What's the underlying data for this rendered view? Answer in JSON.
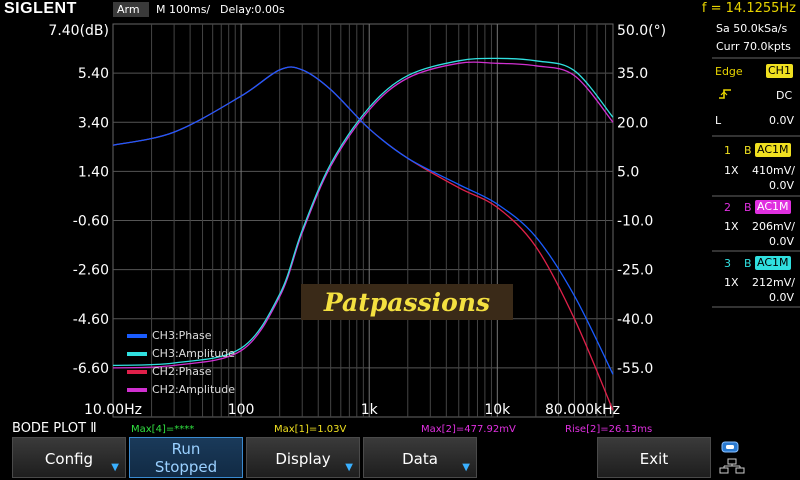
{
  "topbar": {
    "brand": "SIGLENT",
    "trigger_status": "Arm",
    "timebase": "M 100ms/",
    "delay": "Delay:0.00s",
    "frequency": "f = 14.1255Hz"
  },
  "plot": {
    "left_axis_labels": [
      "7.40(dB)",
      "5.40",
      "3.40",
      "1.40",
      "-0.60",
      "-2.60",
      "-4.60",
      "-6.60"
    ],
    "right_axis_labels": [
      "50.0(°)",
      "35.0",
      "20.0",
      "5.0",
      "-10.0",
      "-25.0",
      "-40.0",
      "-55.0"
    ],
    "x_axis_labels": [
      "10.00Hz",
      "100",
      "1k",
      "10k",
      "80.000kHz"
    ],
    "watermark": "Patpassions",
    "legend": [
      {
        "name": "CH3:Phase",
        "color": "#1a5cff"
      },
      {
        "name": "CH3:Amplitude",
        "color": "#30e0e0"
      },
      {
        "name": "CH2:Phase",
        "color": "#e0204a"
      },
      {
        "name": "CH2:Amplitude",
        "color": "#d030d0"
      }
    ]
  },
  "right_panel": {
    "sample_rate": "Sa 50.0kSa/s",
    "memory": "Curr 70.0kpts",
    "trigger": {
      "type_label": "Edge",
      "source": "CH1",
      "coupling": "DC",
      "level_label": "L",
      "level": "0.0V"
    },
    "channels": [
      {
        "num": "1",
        "bw": "B",
        "coupling": "AC1M",
        "probe": "1X",
        "scale": "410mV/",
        "offset": "0.0V",
        "color": "#f0e020"
      },
      {
        "num": "2",
        "bw": "B",
        "coupling": "AC1M",
        "probe": "1X",
        "scale": "206mV/",
        "offset": "0.0V",
        "color": "#e030e0"
      },
      {
        "num": "3",
        "bw": "B",
        "coupling": "AC1M",
        "probe": "1X",
        "scale": "212mV/",
        "offset": "0.0V",
        "color": "#30e0e0"
      }
    ]
  },
  "bottom": {
    "title": "BODE PLOT Ⅱ",
    "measurements": [
      {
        "text": "Max[4]=****",
        "color": "#30e040"
      },
      {
        "text": "Max[1]=1.03V",
        "color": "#f0e020"
      },
      {
        "text": "Max[2]=477.92mV",
        "color": "#e030e0"
      },
      {
        "text": "Rise[2]=26.13ms",
        "color": "#e030e0"
      }
    ]
  },
  "softkeys": {
    "config": "Config",
    "run_line1": "Run",
    "run_line2": "Stopped",
    "display": "Display",
    "data": "Data",
    "exit": "Exit"
  },
  "chart_data": {
    "type": "line",
    "x_scale": "log",
    "x_range_hz": [
      10,
      80000
    ],
    "y_left_range_db": [
      -8.6,
      7.4
    ],
    "y_right_range_deg": [
      -70,
      50
    ],
    "series": [
      {
        "name": "CH3:Amplitude",
        "axis": "left",
        "x": [
          10,
          30,
          100,
          200,
          300,
          500,
          1000,
          2000,
          5000,
          10000,
          20000,
          40000,
          80000
        ],
        "values": [
          -6.5,
          -6.4,
          -5.8,
          -3.6,
          -1.0,
          1.7,
          4.0,
          5.3,
          5.9,
          6.0,
          5.9,
          5.5,
          3.6
        ]
      },
      {
        "name": "CH2:Amplitude",
        "axis": "left",
        "x": [
          10,
          30,
          100,
          200,
          300,
          500,
          1000,
          2000,
          5000,
          10000,
          20000,
          40000,
          80000
        ],
        "values": [
          -6.6,
          -6.5,
          -5.9,
          -3.7,
          -1.1,
          1.6,
          3.9,
          5.2,
          5.8,
          5.8,
          5.7,
          5.3,
          3.4
        ]
      },
      {
        "name": "CH3:Phase",
        "axis": "right",
        "x": [
          10,
          30,
          100,
          200,
          300,
          500,
          1000,
          2000,
          5000,
          10000,
          20000,
          40000,
          80000
        ],
        "values": [
          13,
          17,
          28,
          36,
          36,
          30,
          18,
          9,
          1,
          -5,
          -15,
          -33,
          -57
        ]
      },
      {
        "name": "CH2:Phase",
        "axis": "right",
        "x": [
          10,
          30,
          100,
          200,
          300,
          500,
          1000,
          2000,
          5000,
          10000,
          20000,
          40000,
          80000
        ],
        "values": [
          13,
          17,
          28,
          36,
          36,
          30,
          18,
          9,
          0,
          -6,
          -18,
          -40,
          -68
        ]
      }
    ]
  }
}
